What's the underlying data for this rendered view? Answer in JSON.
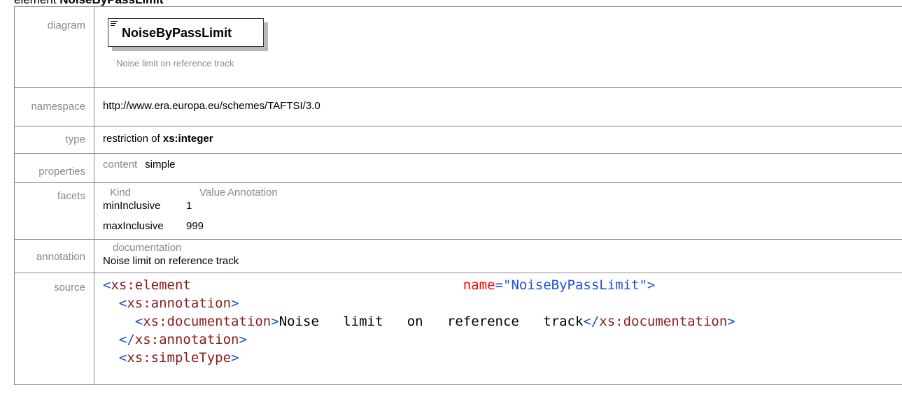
{
  "heading": {
    "prefix": "element",
    "name": "NoiseByPassLimit"
  },
  "rows": {
    "diagram": {
      "label": "diagram",
      "element_name": "NoiseByPassLimit",
      "caption": "Noise limit on reference track"
    },
    "namespace": {
      "label": "namespace",
      "value": "http://www.era.europa.eu/schemes/TAFTSI/3.0"
    },
    "type": {
      "label": "type",
      "prefix": "restriction of",
      "base": "xs:integer"
    },
    "properties": {
      "label": "properties",
      "key": "content",
      "value": "simple"
    },
    "facets": {
      "label": "facets",
      "headers": [
        "Kind",
        "Value",
        "Annotation"
      ],
      "items": [
        {
          "kind": "minInclusive",
          "value": "1"
        },
        {
          "kind": "maxInclusive",
          "value": "999"
        }
      ]
    },
    "annotation": {
      "label": "annotation",
      "key": "documentation",
      "value": "Noise limit on reference track"
    },
    "source": {
      "label": "source",
      "lines": [
        {
          "indent": "",
          "open": "<",
          "tag": "xs:element",
          "attr_gap": "                                  ",
          "attr": "name",
          "eq": "=",
          "attrval": "\"NoiseByPassLimit\"",
          "close": ">"
        },
        {
          "indent": "  ",
          "open": "<",
          "tag": "xs:annotation",
          "close": ">"
        },
        {
          "indent": "    ",
          "open": "<",
          "tag": "xs:documentation",
          "close": ">",
          "text": "Noise   limit   on   reference   track",
          "end_open": "</",
          "end_tag": "xs:documentation",
          "end_close": ">"
        },
        {
          "indent": "  ",
          "open": "</",
          "tag": "xs:annotation",
          "close": ">"
        },
        {
          "indent": "  ",
          "open": "<",
          "tag": "xs:simpleType",
          "close": ">"
        }
      ]
    }
  },
  "colors": {
    "tag": "#8b1a1a",
    "bracket": "#1d4fd8",
    "attribute": "#ff0000",
    "label": "#8a8a8a",
    "border": "#888888"
  }
}
